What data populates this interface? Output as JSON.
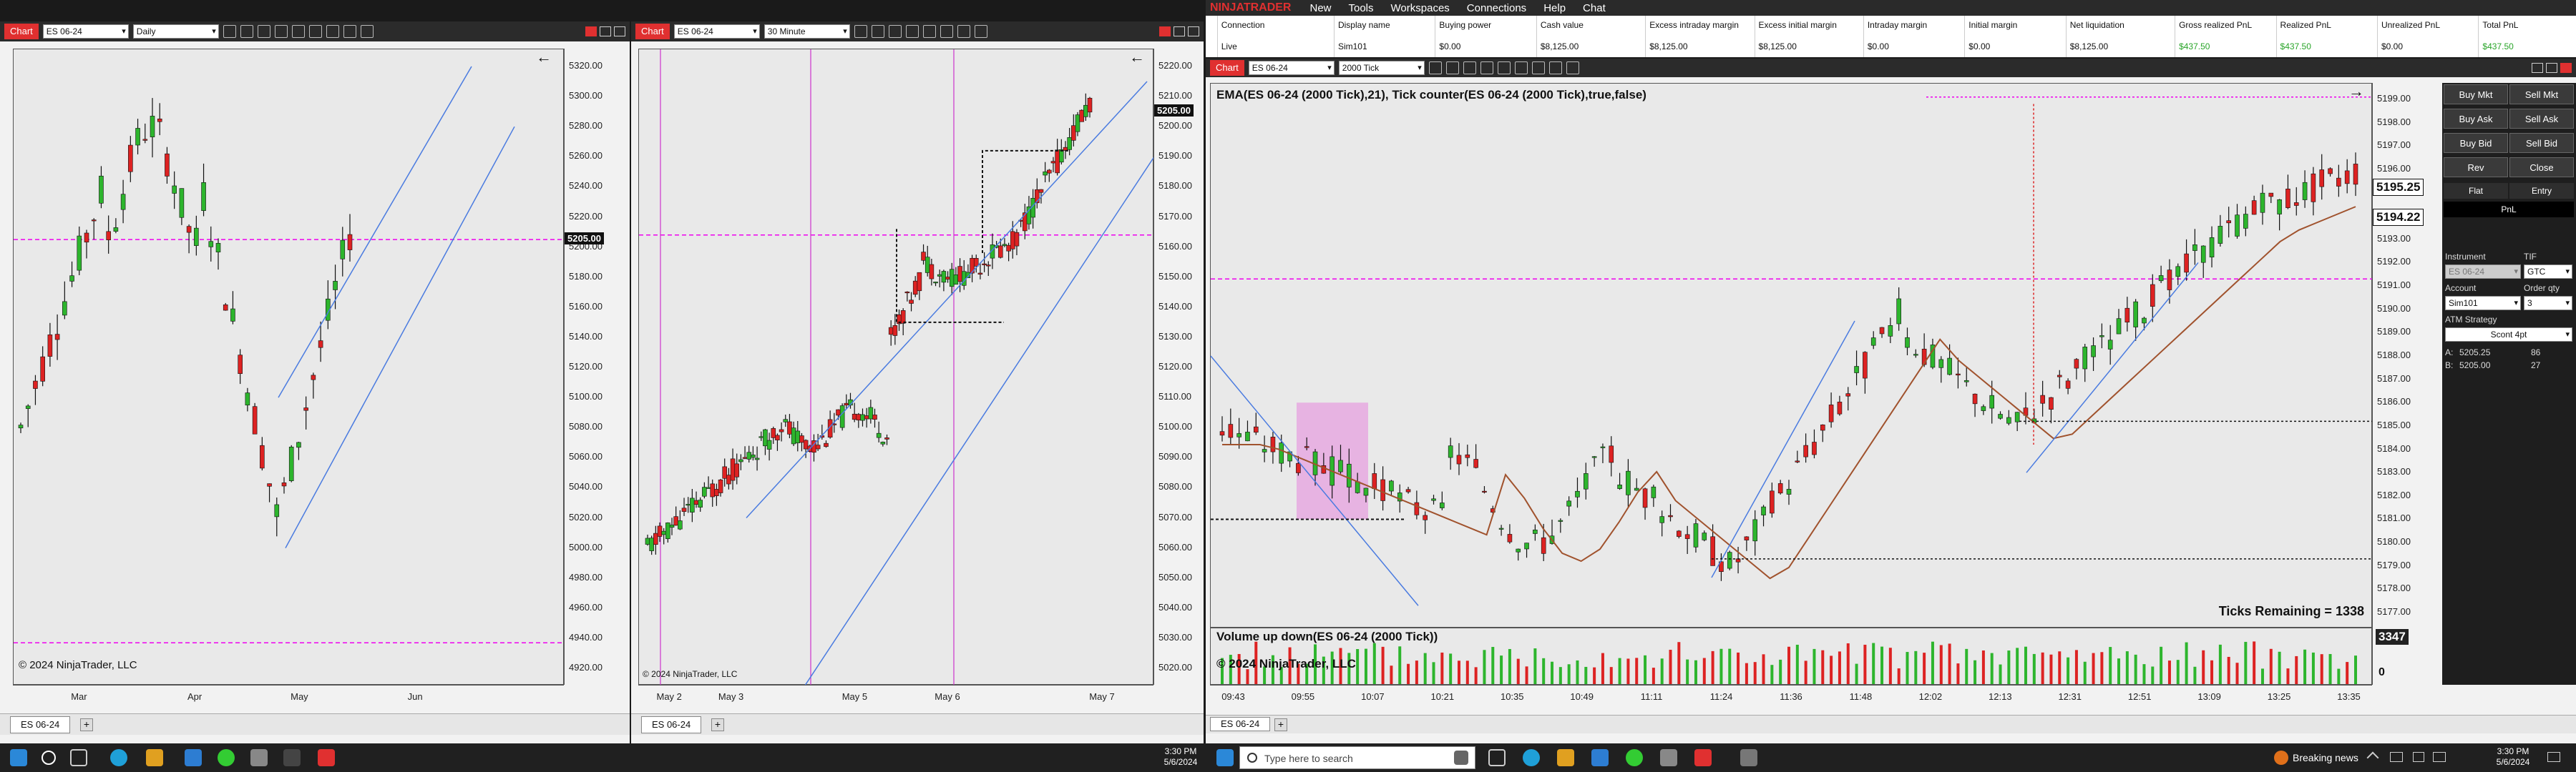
{
  "chart1": {
    "tag": "Chart",
    "instrument": "ES 06-24",
    "period": "Daily",
    "current_price": "5205.00",
    "price_labels": [
      "5320.00",
      "5300.00",
      "5280.00",
      "5260.00",
      "5240.00",
      "5220.00",
      "5200.00",
      "5180.00",
      "5160.00",
      "5140.00",
      "5120.00",
      "5100.00",
      "5080.00",
      "5060.00",
      "5040.00",
      "5020.00",
      "5000.00",
      "4980.00",
      "4960.00",
      "4940.00",
      "4920.00"
    ],
    "x_labels": [
      "Mar",
      "Apr",
      "May",
      "Jun"
    ],
    "copyright": "© 2024 NinjaTrader, LLC",
    "tab": "ES 06-24",
    "tab_add": "+"
  },
  "chart2": {
    "tag": "Chart",
    "instrument": "ES 06-24",
    "period": "30 Minute",
    "current_price": "5205.00",
    "price_labels": [
      "5220.00",
      "5210.00",
      "5200.00",
      "5190.00",
      "5180.00",
      "5170.00",
      "5160.00",
      "5150.00",
      "5140.00",
      "5130.00",
      "5120.00",
      "5110.00",
      "5100.00",
      "5090.00",
      "5080.00",
      "5070.00",
      "5060.00",
      "5050.00",
      "5040.00",
      "5030.00",
      "5020.00"
    ],
    "x_labels": [
      "May 2",
      "May 3",
      "May 5",
      "May 6",
      "May 7"
    ],
    "copyright": "© 2024 NinjaTrader, LLC",
    "tab": "ES 06-24",
    "tab_add": "+"
  },
  "app": {
    "brand": "NINJATRADER",
    "menu": [
      "New",
      "Tools",
      "Workspaces",
      "Connections",
      "Help",
      "Chat"
    ]
  },
  "accounts": {
    "headers": [
      "Connection",
      "Display name",
      "Buying power",
      "Cash value",
      "Excess intraday margin",
      "Excess initial margin",
      "Intraday margin",
      "Initial margin",
      "Net liquidation",
      "Gross realized PnL",
      "Realized PnL",
      "Unrealized PnL",
      "Total PnL"
    ],
    "row": [
      "Live",
      "Sim101",
      "$0.00",
      "$8,125.00",
      "$8,125.00",
      "$8,125.00",
      "$0.00",
      "$0.00",
      "$8,125.00",
      "$437.50",
      "$437.50",
      "$0.00",
      "$437.50"
    ]
  },
  "chart3": {
    "tag": "Chart",
    "instrument": "ES 06-24",
    "period": "2000 Tick",
    "indicator_label": "EMA(ES 06-24 (2000 Tick),21), Tick counter(ES 06-24 (2000 Tick),true,false)",
    "volume_label": "Volume up down(ES 06-24 (2000 Tick))",
    "ticks_remaining": "Ticks Remaining = 1338",
    "current_price": "5195.25",
    "bid_price": "5194.22",
    "volume_value": "3347",
    "volume_zero": "0",
    "price_labels": [
      "5199.00",
      "5198.00",
      "5197.00",
      "5196.00",
      "5195.00",
      "5194.00",
      "5193.00",
      "5192.00",
      "5191.00",
      "5190.00",
      "5189.00",
      "5188.00",
      "5187.00",
      "5186.00",
      "5185.00",
      "5184.00",
      "5183.00",
      "5182.00",
      "5181.00",
      "5180.00",
      "5179.00",
      "5178.00",
      "5177.00"
    ],
    "x_labels": [
      "09:43",
      "09:55",
      "10:07",
      "10:21",
      "10:35",
      "10:49",
      "11:11",
      "11:24",
      "11:36",
      "11:48",
      "12:02",
      "12:13",
      "12:31",
      "12:51",
      "13:09",
      "13:25",
      "13:35"
    ],
    "copyright": "© 2024 NinjaTrader, LLC",
    "tab": "ES 06-24",
    "tab_add": "+"
  },
  "chart_trader": {
    "buttons": [
      "Buy Mkt",
      "Sell Mkt",
      "Buy Ask",
      "Sell Ask",
      "Buy Bid",
      "Sell Bid",
      "Rev",
      "Close"
    ],
    "flat": "Flat",
    "entry": "Entry",
    "pnl": "PnL",
    "instrument_label": "Instrument",
    "instrument_value": "ES 06-24",
    "tif_label": "TIF",
    "tif_value": "GTC",
    "account_label": "Account",
    "account_value": "Sim101",
    "qty_label": "Order qty",
    "qty_value": "3",
    "atm_label": "ATM Strategy",
    "atm_value": "Scont 4pt",
    "ask_label": "A:",
    "ask_price": "5205.25",
    "ask_size": "86",
    "bid_label": "B:",
    "bid_price": "5205.00",
    "bid_size": "27"
  },
  "taskbar": {
    "search_placeholder": "Type here to search",
    "time_left": "3:30 PM",
    "date_left": "5/6/2024",
    "time_right": "3:30 PM",
    "date_right": "5/6/2024",
    "news": "Breaking news"
  }
}
